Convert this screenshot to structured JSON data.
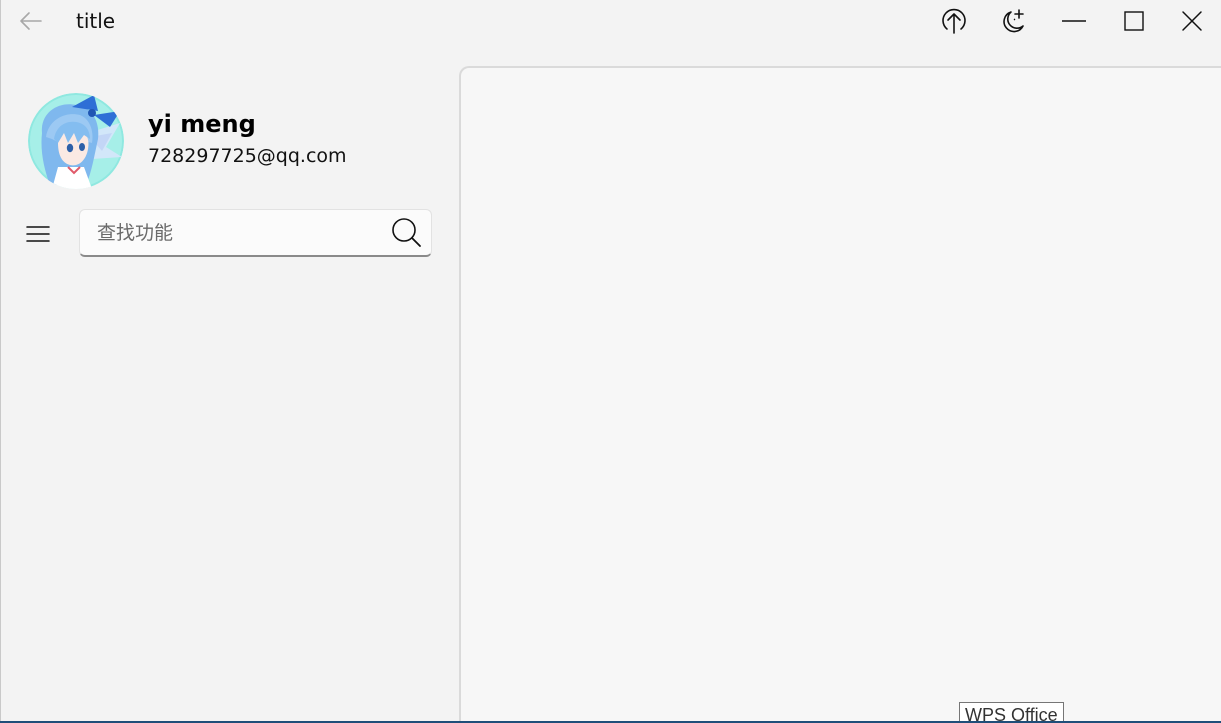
{
  "window": {
    "title": "title"
  },
  "titlebar": {
    "back_icon": "arrow-left-icon",
    "buttons": [
      {
        "name": "upload",
        "icon": "upload-arrow-icon"
      },
      {
        "name": "theme",
        "icon": "moon-sparkle-icon"
      },
      {
        "name": "minimize",
        "icon": "minimize-icon"
      },
      {
        "name": "maximize",
        "icon": "maximize-icon"
      },
      {
        "name": "close",
        "icon": "close-icon"
      }
    ]
  },
  "profile": {
    "name": "yi meng",
    "email": "728297725@qq.com",
    "avatar_icon": "anime-avatar-image"
  },
  "search": {
    "placeholder": "查找功能",
    "value": "",
    "icon": "search-icon"
  },
  "menu": {
    "icon": "hamburger-menu-icon"
  },
  "tooltip": {
    "text": "WPS Office"
  },
  "colors": {
    "background": "#f3f3f3",
    "content_background": "#f7f7f7",
    "search_underline": "#8a8a8a",
    "avatar_bg": "#8fe8e0"
  }
}
